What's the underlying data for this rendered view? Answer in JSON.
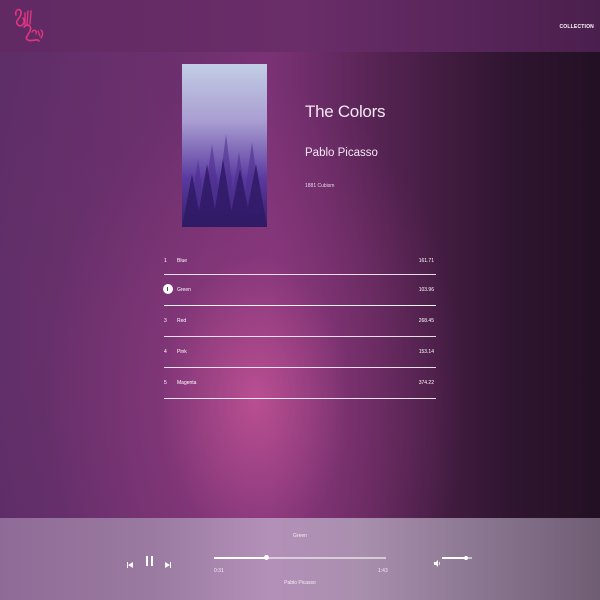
{
  "header": {
    "logo_text": "Bill Jam",
    "nav": {
      "collection_label": "COLLECTION"
    }
  },
  "album": {
    "cover_icon": "forest-fog-cover-image",
    "title": "The Colors",
    "artist": "Pablo Picasso",
    "meta": "1881 Cubism"
  },
  "tracklist": {
    "tracks": [
      {
        "number": "1",
        "name": "Blue",
        "duration": "161.71",
        "playing": false
      },
      {
        "number": "2",
        "name": "Green",
        "duration": "103.96",
        "playing": true
      },
      {
        "number": "3",
        "name": "Red",
        "duration": "268.45",
        "playing": false
      },
      {
        "number": "4",
        "name": "Pink",
        "duration": "153.14",
        "playing": false
      },
      {
        "number": "5",
        "name": "Magenta",
        "duration": "374.22",
        "playing": false
      }
    ]
  },
  "player": {
    "now_playing_title": "Green",
    "now_playing_artist": "Pablo Picasso",
    "elapsed": "0:31",
    "total": "1:43",
    "progress_fraction": 0.3,
    "volume_fraction": 0.8,
    "icons": {
      "prev": "skip-previous-icon",
      "pause": "pause-icon",
      "next": "skip-next-icon",
      "volume": "volume-icon"
    }
  },
  "colors": {
    "accent_pink": "#e0357f",
    "white": "#ffffff"
  }
}
